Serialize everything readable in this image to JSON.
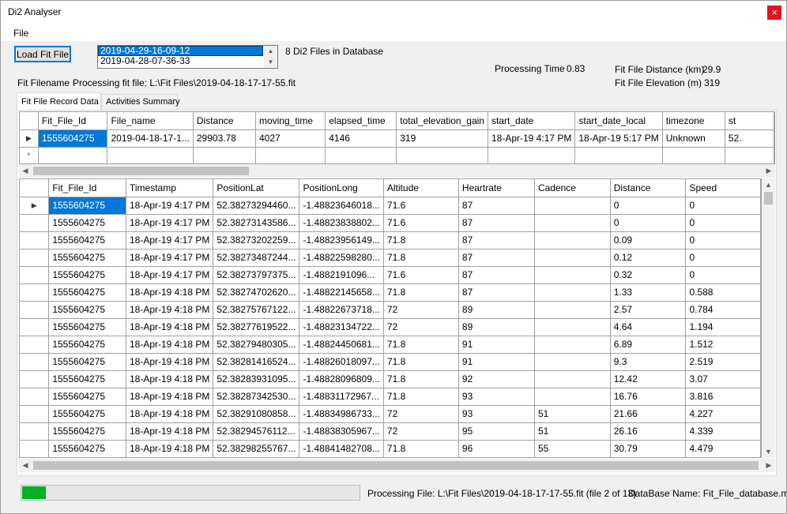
{
  "window": {
    "title": "Di2 Analyser",
    "close_glyph": "×"
  },
  "menu": {
    "file": "File"
  },
  "toolbar": {
    "load_button": "Load Fit File"
  },
  "file_list": {
    "items": [
      "2019-04-29-16-09-12",
      "2019-04-28-07-36-33"
    ],
    "selected_index": 0
  },
  "db_count_text": "8 Di2 Files in Database",
  "processing_time": {
    "label": "Processing Time",
    "value": "0.83"
  },
  "fit_distance": {
    "label": "Fit File Distance (km)",
    "value": "29.9"
  },
  "fit_elevation": {
    "label": "Fit File Elevation (m)",
    "value": "319"
  },
  "fit_filename": {
    "label": "Fit Filename",
    "value": "Processing fit file: L:\\Fit Files\\2019-04-18-17-17-55.fit"
  },
  "tabs": [
    {
      "label": "Fit File Record Data",
      "active": true
    },
    {
      "label": "Activities Summary",
      "active": false
    }
  ],
  "activities_grid": {
    "columns": [
      "Fit_File_Id",
      "File_name",
      "Distance",
      "moving_time",
      "elapsed_time",
      "total_elevation_gain",
      "start_date",
      "start_date_local",
      "timezone",
      "st"
    ],
    "rows": [
      [
        "1555604275",
        "2019-04-18-17-1...",
        "29903.78",
        "4027",
        "4146",
        "319",
        "18-Apr-19 4:17 PM",
        "18-Apr-19 5:17 PM",
        "Unknown",
        "52."
      ]
    ]
  },
  "records_grid": {
    "columns": [
      "Fit_File_Id",
      "Timestamp",
      "PositionLat",
      "PositionLong",
      "Altitude",
      "Heartrate",
      "Cadence",
      "Distance",
      "Speed"
    ],
    "rows": [
      [
        "1555604275",
        "18-Apr-19 4:17 PM",
        "52.38273294460...",
        "-1.48823646018...",
        "71.6",
        "87",
        "",
        "0",
        "0"
      ],
      [
        "1555604275",
        "18-Apr-19 4:17 PM",
        "52.38273143586...",
        "-1.48823838802...",
        "71.6",
        "87",
        "",
        "0",
        "0"
      ],
      [
        "1555604275",
        "18-Apr-19 4:17 PM",
        "52.38273202259...",
        "-1.48823956149...",
        "71.8",
        "87",
        "",
        "0.09",
        "0"
      ],
      [
        "1555604275",
        "18-Apr-19 4:17 PM",
        "52.38273487244...",
        "-1.48822598280...",
        "71.8",
        "87",
        "",
        "0.12",
        "0"
      ],
      [
        "1555604275",
        "18-Apr-19 4:17 PM",
        "52.38273797375...",
        "-1.4882191096...",
        "71.6",
        "87",
        "",
        "0.32",
        "0"
      ],
      [
        "1555604275",
        "18-Apr-19 4:18 PM",
        "52.38274702620...",
        "-1.48822145658...",
        "71.8",
        "87",
        "",
        "1.33",
        "0.588"
      ],
      [
        "1555604275",
        "18-Apr-19 4:18 PM",
        "52.38275767122...",
        "-1.48822673718...",
        "72",
        "89",
        "",
        "2.57",
        "0.784"
      ],
      [
        "1555604275",
        "18-Apr-19 4:18 PM",
        "52.38277619522...",
        "-1.48823134722...",
        "72",
        "89",
        "",
        "4.64",
        "1.194"
      ],
      [
        "1555604275",
        "18-Apr-19 4:18 PM",
        "52.38279480305...",
        "-1.48824450681...",
        "71.8",
        "91",
        "",
        "6.89",
        "1.512"
      ],
      [
        "1555604275",
        "18-Apr-19 4:18 PM",
        "52.38281416524...",
        "-1.48826018097...",
        "71.8",
        "91",
        "",
        "9.3",
        "2.519"
      ],
      [
        "1555604275",
        "18-Apr-19 4:18 PM",
        "52.38283931095...",
        "-1.48828096809...",
        "71.8",
        "92",
        "",
        "12.42",
        "3.07"
      ],
      [
        "1555604275",
        "18-Apr-19 4:18 PM",
        "52.38287342530...",
        "-1.48831172967...",
        "71.8",
        "93",
        "",
        "16.76",
        "3.816"
      ],
      [
        "1555604275",
        "18-Apr-19 4:18 PM",
        "52.38291080858...",
        "-1.48834986733...",
        "72",
        "93",
        "51",
        "21.66",
        "4.227"
      ],
      [
        "1555604275",
        "18-Apr-19 4:18 PM",
        "52.38294576112...",
        "-1.48838305967...",
        "72",
        "95",
        "51",
        "26.16",
        "4.339"
      ],
      [
        "1555604275",
        "18-Apr-19 4:18 PM",
        "52.38298255767...",
        "-1.48841482708...",
        "71.8",
        "96",
        "55",
        "30.79",
        "4.479"
      ]
    ]
  },
  "status": {
    "processing_file": "Processing File: L:\\Fit Files\\2019-04-18-17-17-55.fit (file 2 of 13)",
    "database_name": "DataBase Name: Fit_File_database.mdf",
    "progress": 0.07
  },
  "colors": {
    "selection": "#0078d7",
    "progress_fill": "#06b025",
    "close_button": "#e81123"
  }
}
